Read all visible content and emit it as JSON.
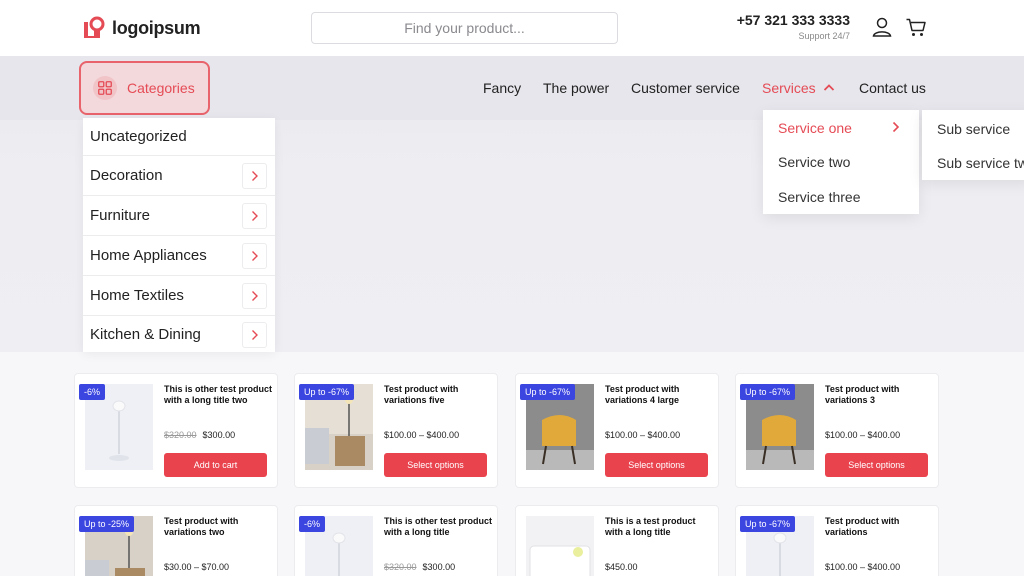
{
  "header": {
    "logo_text": "logoipsum",
    "search_placeholder": "Find your product...",
    "phone": "+57 321 333 3333",
    "support": "Support 24/7"
  },
  "categories_button": {
    "label": "Categories"
  },
  "nav": {
    "items": [
      {
        "label": "Fancy"
      },
      {
        "label": "The power"
      },
      {
        "label": "Customer service"
      },
      {
        "label": "Services"
      },
      {
        "label": "Contact us"
      }
    ]
  },
  "categories_menu": {
    "items": [
      {
        "label": "Uncategorized"
      },
      {
        "label": "Decoration"
      },
      {
        "label": "Furniture"
      },
      {
        "label": "Home Appliances"
      },
      {
        "label": "Home Textiles"
      },
      {
        "label": "Kitchen & Dining"
      }
    ]
  },
  "services_menu": {
    "items": [
      {
        "label": "Service one"
      },
      {
        "label": "Service two"
      },
      {
        "label": "Service three"
      }
    ],
    "sub_items": [
      {
        "label": "Sub service"
      },
      {
        "label": "Sub service two"
      }
    ]
  },
  "products": [
    {
      "badge": "-6%",
      "title": "This is other test product with a long title two",
      "old_price": "$320.00",
      "price": "$300.00",
      "button": "Add to cart"
    },
    {
      "badge": "Up to -67%",
      "title": "Test product with variations five",
      "price": "$100.00 – $400.00",
      "button": "Select options"
    },
    {
      "badge": "Up to -67%",
      "title": "Test product with variations 4 large",
      "price": "$100.00 – $400.00",
      "button": "Select options"
    },
    {
      "badge": "Up to -67%",
      "title": "Test product with variations 3",
      "price": "$100.00 – $400.00",
      "button": "Select options"
    },
    {
      "badge": "Up to -25%",
      "title": "Test product with variations two",
      "price": "$30.00 – $70.00"
    },
    {
      "badge": "-6%",
      "title": "This is other test product with a long title",
      "old_price": "$320.00",
      "price": "$300.00"
    },
    {
      "title": "This is a test product with a long title",
      "price": "$450.00"
    },
    {
      "badge": "Up to -67%",
      "title": "Test product with variations",
      "price": "$100.00 – $400.00"
    }
  ],
  "colors": {
    "accent": "#e9434e",
    "badge": "#3b45e0",
    "hero": "#eeeef2"
  }
}
